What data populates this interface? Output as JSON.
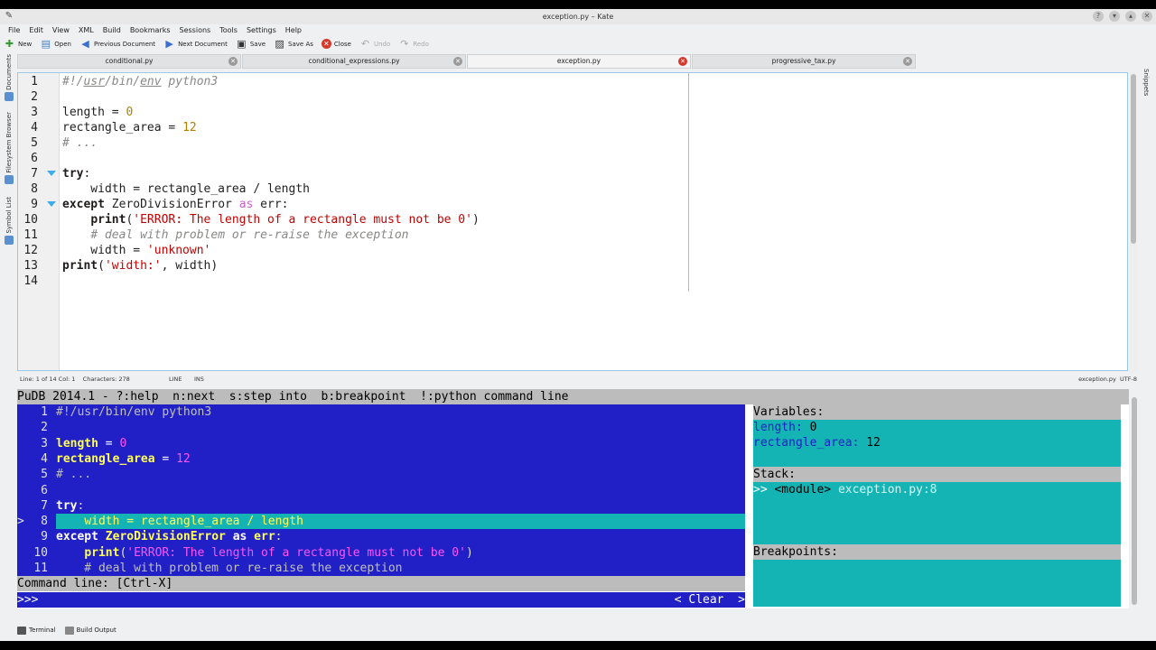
{
  "window": {
    "title": "exception.py – Kate"
  },
  "menu": [
    "File",
    "Edit",
    "View",
    "XML",
    "Build",
    "Bookmarks",
    "Sessions",
    "Tools",
    "Settings",
    "Help"
  ],
  "toolbar": {
    "new": "New",
    "open": "Open",
    "prev": "Previous Document",
    "next": "Next Document",
    "save": "Save",
    "save_as": "Save As",
    "close": "Close",
    "undo": "Undo",
    "redo": "Redo"
  },
  "left_panels": [
    "Documents",
    "Filesystem Browser",
    "Symbol List"
  ],
  "right_panels": [
    "Snippets"
  ],
  "tabs": [
    {
      "label": "conditional.py"
    },
    {
      "label": "conditional_expressions.py"
    },
    {
      "label": "exception.py",
      "active": true
    },
    {
      "label": "progressive_tax.py"
    }
  ],
  "editor": {
    "line_numbers": [
      "1",
      "2",
      "3",
      "4",
      "5",
      "6",
      "7",
      "8",
      "9",
      "10",
      "11",
      "12",
      "13",
      "14"
    ],
    "fold_lines": [
      7,
      9
    ]
  },
  "status": {
    "position": "Line: 1 of 14 Col: 1",
    "characters": "Characters: 278",
    "mode": "LINE",
    "ins": "INS",
    "file": "exception.py",
    "encoding": "UTF-8"
  },
  "pudb": {
    "header": "PuDB 2014.1 - ?:help  n:next  s:step into  b:breakpoint  !:python command line",
    "current_marker": ">",
    "line_numbers": [
      "1",
      "2",
      "3",
      "4",
      "5",
      "6",
      "7",
      "8",
      "9",
      "10",
      "11"
    ],
    "command_label": "Command line: [Ctrl-X]",
    "prompt": ">>>",
    "clear": "< Clear  >",
    "variables_title": "Variables:",
    "variables": [
      {
        "name": "length:",
        "value": "0"
      },
      {
        "name": "rectangle_area:",
        "value": "12"
      }
    ],
    "stack_title": "Stack:",
    "stack": {
      "marker": ">>",
      "frame": "<module>",
      "location": "exception.py:8"
    },
    "breakpoints_title": "Breakpoints:"
  },
  "bottom_tabs": [
    "Terminal",
    "Build Output"
  ],
  "colors": {
    "pudb_blue": "#2020c6",
    "pudb_cyan": "#14b4b4",
    "pudb_grey": "#bcbcbc",
    "kate_selection": "#3daee9"
  }
}
